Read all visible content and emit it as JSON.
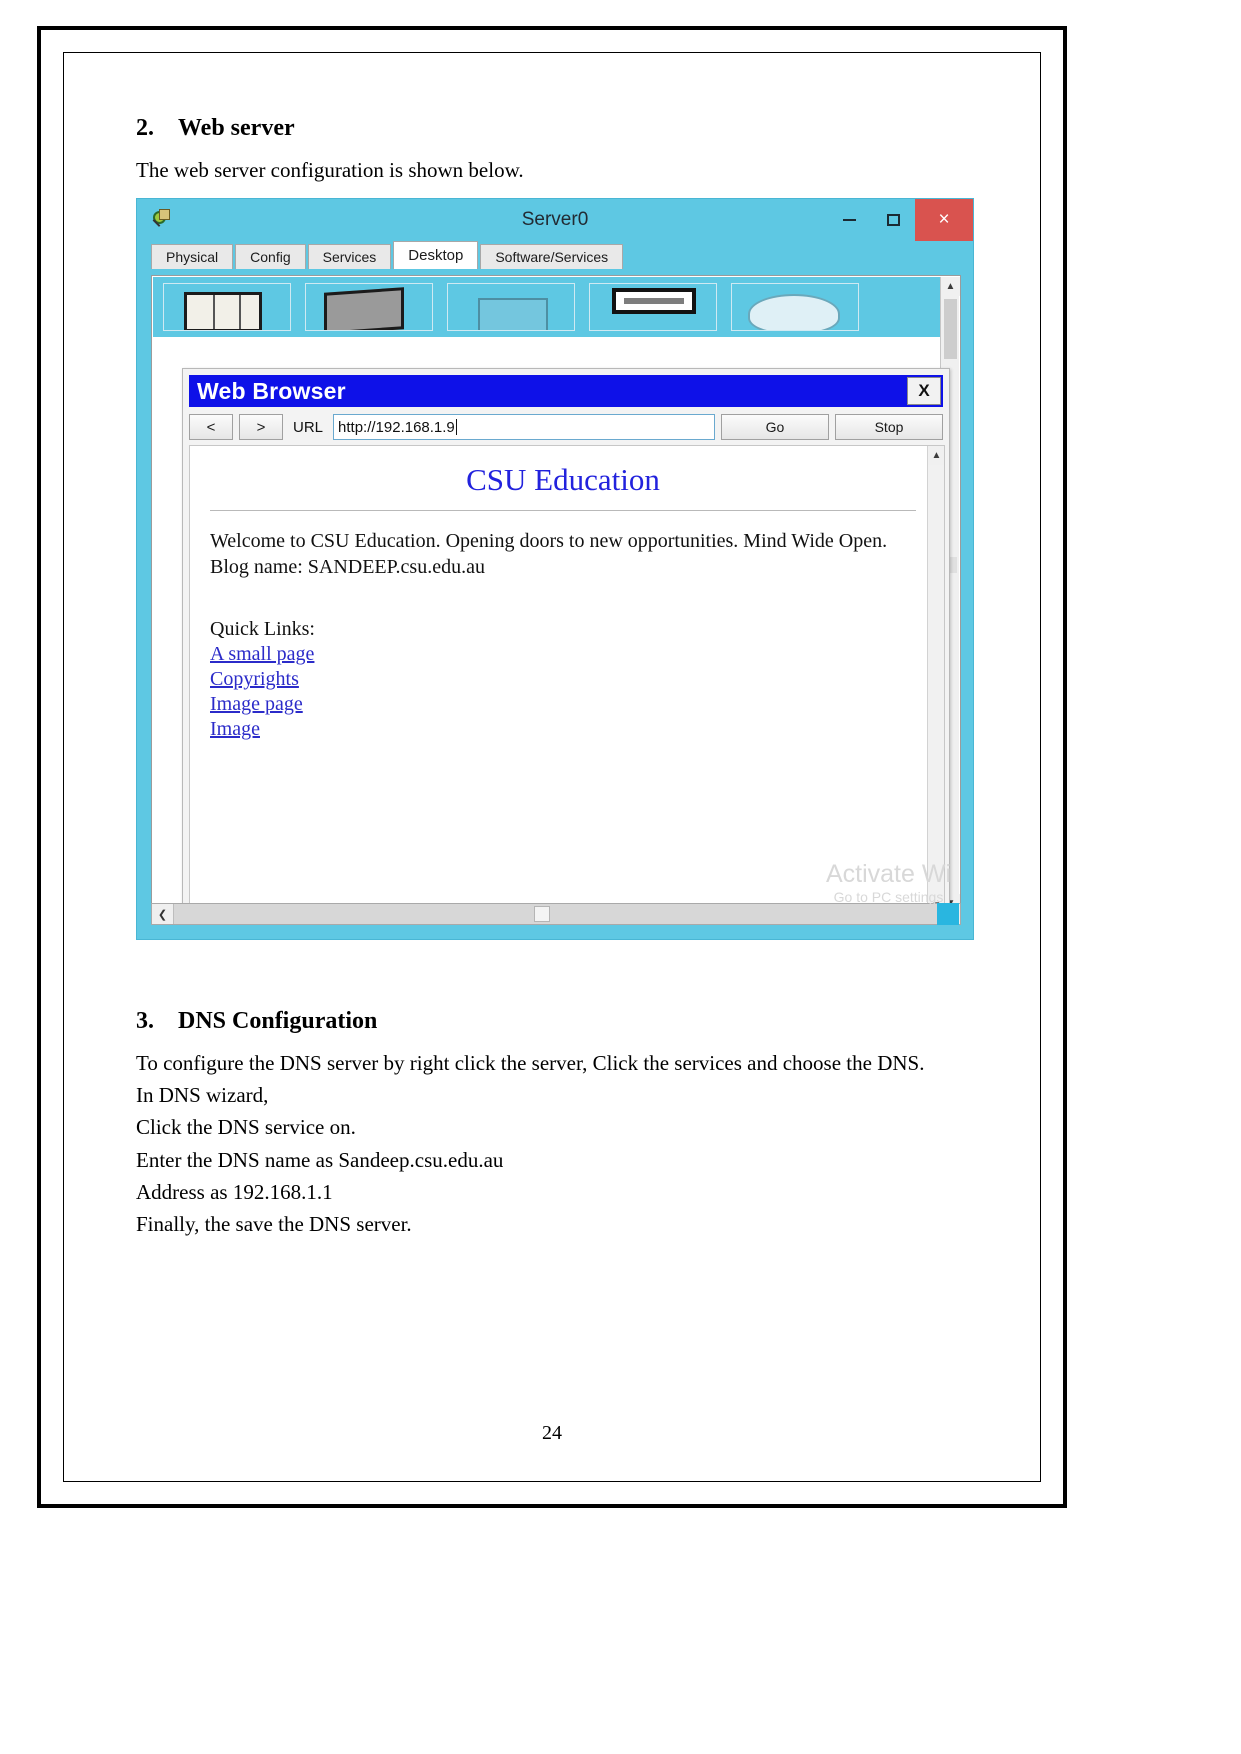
{
  "document": {
    "section2": {
      "number": "2.",
      "title": "Web server",
      "intro": "The web server configuration is shown below."
    },
    "section3": {
      "number": "3.",
      "title": "DNS Configuration",
      "lines": [
        "To configure the DNS server by right click the server, Click the services and choose the DNS.",
        "In DNS wizard,",
        "Click the DNS service on.",
        "Enter the DNS name as Sandeep.csu.edu.au",
        "Address as 192.168.1.1",
        "Finally, the save the DNS server."
      ]
    },
    "page_number": "24"
  },
  "packet_tracer": {
    "window_title": "Server0",
    "window_buttons": {
      "minimize": "–",
      "maximize": "□",
      "close": "×"
    },
    "tabs": [
      {
        "label": "Physical",
        "active": false
      },
      {
        "label": "Config",
        "active": false
      },
      {
        "label": "Services",
        "active": false
      },
      {
        "label": "Desktop",
        "active": true
      },
      {
        "label": "Software/Services",
        "active": false
      }
    ],
    "titlebar_color": "#5ec8e3",
    "scroll": {
      "up_arrow": "▲",
      "down_arrow": "▼",
      "left_arrow": "❮",
      "right_arrow": "❯"
    }
  },
  "web_browser": {
    "title": "Web Browser",
    "title_bg": "#0e11e8",
    "close_label": "X",
    "toolbar": {
      "back_label": "<",
      "forward_label": ">",
      "url_label": "URL",
      "url_value": "http://192.168.1.9",
      "go_label": "Go",
      "stop_label": "Stop"
    },
    "page": {
      "heading": "CSU Education",
      "heading_color": "#2222dd",
      "body": "Welcome to CSU Education. Opening doors to new opportunities. Mind Wide Open. Blog name: SANDEEP.csu.edu.au",
      "quick_links_label": "Quick Links:",
      "links": [
        "A small page",
        "Copyrights",
        "Image page",
        "Image"
      ],
      "link_color": "#2b2bc9"
    },
    "page_scroll": {
      "up": "▲",
      "down": "▼",
      "left": "‹",
      "right": "›"
    }
  },
  "watermark": {
    "line1": "Activate Wi",
    "line2": "Go to PC settings"
  }
}
